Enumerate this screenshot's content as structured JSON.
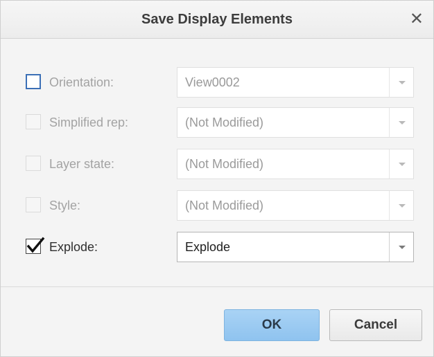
{
  "window": {
    "title": "Save Display Elements",
    "close_glyph": "✕"
  },
  "rows": [
    {
      "label": "Orientation:",
      "value": "View0002",
      "checked": false,
      "enabled": false,
      "checkbox_focused": true
    },
    {
      "label": "Simplified rep:",
      "value": "(Not Modified)",
      "checked": false,
      "enabled": false
    },
    {
      "label": "Layer state:",
      "value": "(Not Modified)",
      "checked": false,
      "enabled": false
    },
    {
      "label": "Style:",
      "value": "(Not Modified)",
      "checked": false,
      "enabled": false
    },
    {
      "label": "Explode:",
      "value": "Explode",
      "checked": true,
      "enabled": true
    }
  ],
  "buttons": {
    "ok": "OK",
    "cancel": "Cancel"
  },
  "colors": {
    "ok_button": "#9ccbf2",
    "focus_border": "#3b6fb6"
  }
}
